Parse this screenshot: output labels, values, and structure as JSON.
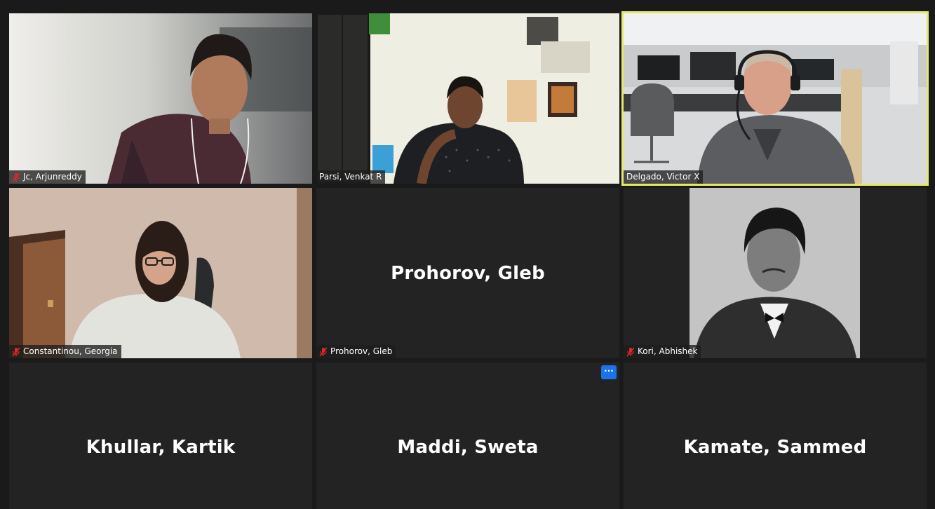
{
  "participants": [
    {
      "name": "Jc, Arjunreddy",
      "muted": true,
      "video": true,
      "active": false
    },
    {
      "name": "Parsi, Venkat R",
      "muted": false,
      "video": true,
      "active": false
    },
    {
      "name": "Delgado, Victor X",
      "muted": false,
      "video": true,
      "active": true
    },
    {
      "name": "Constantinou, Georgia",
      "muted": true,
      "video": true,
      "active": false
    },
    {
      "name": "Prohorov, Gleb",
      "muted": true,
      "video": false,
      "active": false
    },
    {
      "name": "Kori, Abhishek",
      "muted": true,
      "video": true,
      "active": false
    },
    {
      "name": "Khullar, Kartik",
      "muted": false,
      "video": false,
      "active": false
    },
    {
      "name": "Maddi, Sweta",
      "muted": false,
      "video": false,
      "active": false
    },
    {
      "name": "Kamate, Sammed",
      "muted": false,
      "video": false,
      "active": false
    }
  ],
  "more_button_label": "···",
  "colors": {
    "background": "#1a1a1a",
    "tile": "#232323",
    "active_speaker_border": "#e4e96b",
    "muted_icon": "#e02828",
    "more_button": "#1a73e8"
  }
}
